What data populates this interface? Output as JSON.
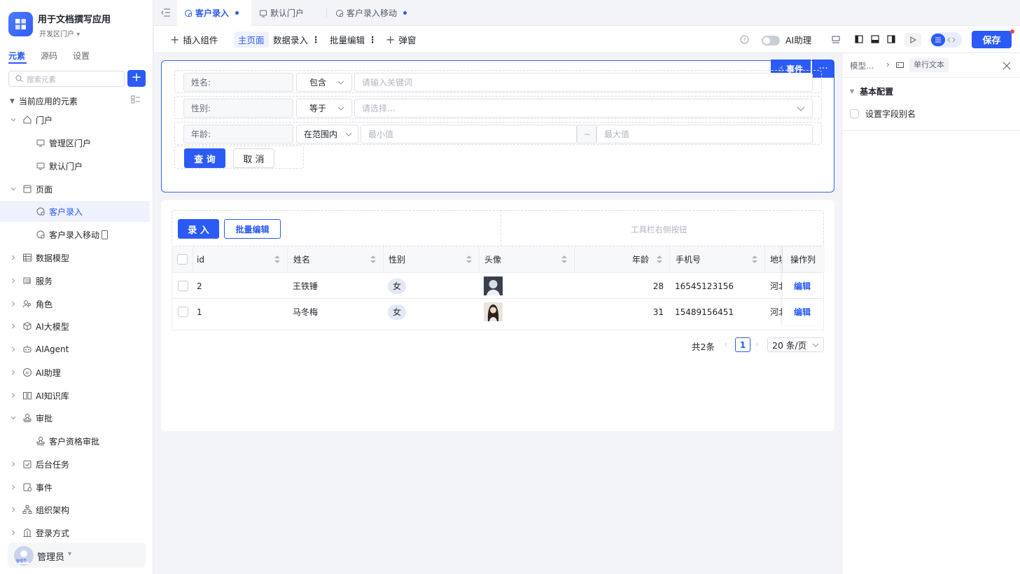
{
  "app": {
    "title": "用于文档撰写应用",
    "portal": "开发区门户"
  },
  "sidebar": {
    "tabs": [
      "元素",
      "源码",
      "设置"
    ],
    "search_placeholder": "搜索元素",
    "section": "当前应用的元素",
    "items": [
      {
        "label": "门户",
        "level": 0,
        "expanded": true,
        "icon": "home-icon"
      },
      {
        "label": "管理区门户",
        "level": 1,
        "icon": "portal-icon"
      },
      {
        "label": "默认门户",
        "level": 1,
        "icon": "portal-icon"
      },
      {
        "label": "页面",
        "level": 0,
        "expanded": true,
        "icon": "page-icon"
      },
      {
        "label": "客户录入",
        "level": 1,
        "icon": "page-item-icon",
        "selected": true
      },
      {
        "label": "客户录入移动",
        "level": 1,
        "icon": "page-item-icon",
        "mobile": true
      },
      {
        "label": "数据模型",
        "level": 0,
        "icon": "table-icon"
      },
      {
        "label": "服务",
        "level": 0,
        "icon": "service-icon"
      },
      {
        "label": "角色",
        "level": 0,
        "icon": "role-icon"
      },
      {
        "label": "AI大模型",
        "level": 0,
        "icon": "cube-icon"
      },
      {
        "label": "AIAgent",
        "level": 0,
        "icon": "robot-icon"
      },
      {
        "label": "AI助理",
        "level": 0,
        "icon": "ai-icon"
      },
      {
        "label": "AI知识库",
        "level": 0,
        "icon": "book-icon"
      },
      {
        "label": "审批",
        "level": 0,
        "expanded": true,
        "icon": "stamp-icon"
      },
      {
        "label": "客户资格审批",
        "level": 1,
        "icon": "stamp-icon"
      },
      {
        "label": "后台任务",
        "level": 0,
        "icon": "task-icon"
      },
      {
        "label": "事件",
        "level": 0,
        "icon": "event-icon"
      },
      {
        "label": "组织架构",
        "level": 0,
        "icon": "org-icon"
      },
      {
        "label": "登录方式",
        "level": 0,
        "icon": "login-icon"
      }
    ],
    "user": {
      "name": "管理员",
      "avatar_text": "管理员"
    }
  },
  "tabs": [
    {
      "label": "客户录入",
      "active": true,
      "dirty": true
    },
    {
      "label": "默认门户",
      "active": false,
      "dirty": false
    },
    {
      "label": "客户录入移动",
      "active": false,
      "dirty": true
    }
  ],
  "toolbar": {
    "insert": "插入组件",
    "main_page": "主页面",
    "data_entry": "数据录入",
    "batch_edit": "批量编辑",
    "popup": "弹窗",
    "ai_assistant": "AI助理",
    "save": "保存"
  },
  "filter": {
    "event_btn": "事件",
    "rows": [
      {
        "label": "姓名:",
        "op": "包含",
        "placeholder": "请输入关键词"
      },
      {
        "label": "性别:",
        "op": "等于",
        "placeholder": "请选择..."
      },
      {
        "label": "年龄:",
        "op": "在范围内",
        "min_placeholder": "最小值",
        "sep": "~",
        "max_placeholder": "最大值"
      }
    ],
    "query": "查 询",
    "cancel": "取 消"
  },
  "table": {
    "add_btn": "录 入",
    "batch_btn": "批量编辑",
    "right_toolbar": "工具栏右侧按钮",
    "columns": [
      "id",
      "姓名",
      "性别",
      "头像",
      "年龄",
      "手机号",
      "地址",
      "操作列"
    ],
    "rows": [
      {
        "id": "2",
        "name": "王铁锤",
        "gender": "女",
        "age": "28",
        "phone": "16545123156",
        "addr": "河北",
        "action": "编辑"
      },
      {
        "id": "1",
        "name": "马冬梅",
        "gender": "女",
        "age": "31",
        "phone": "15489156451",
        "addr": "河北",
        "action": "编辑"
      }
    ],
    "total": "共2条",
    "page": "1",
    "page_size": "20 条/页"
  },
  "rpanel": {
    "crumb1": "模型…",
    "crumb2": "单行文本",
    "section": "基本配置",
    "option": "设置字段别名"
  },
  "colors": {
    "primary": "#2b5af5",
    "danger": "#f54a45"
  }
}
